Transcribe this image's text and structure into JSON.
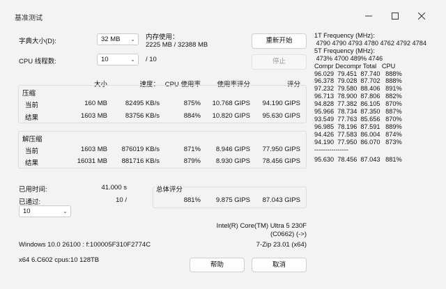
{
  "window": {
    "title": "基准测试"
  },
  "controls": {
    "dict_label": "字典大小(D):",
    "dict_value": "32 MB",
    "threads_label": "CPU 线程数:",
    "threads_value": "10",
    "threads_total": "/ 10",
    "mem_label": "内存使用：",
    "mem_value": "2225 MB / 32388 MB",
    "restart_label": "重新开始",
    "stop_label": "停止"
  },
  "table": {
    "headers": {
      "size": "大小",
      "speed": "速度：",
      "cpu": "CPU 使用率",
      "rating_per_usage": "使用率评分",
      "rating": "评分"
    },
    "compress": {
      "title": "压缩",
      "rows": [
        {
          "label": "当前",
          "size": "160 MB",
          "speed": "82495 KB/s",
          "cpu": "875%",
          "rpu": "10.768 GIPS",
          "rating": "94.190 GIPS"
        },
        {
          "label": "结果",
          "size": "1603 MB",
          "speed": "83756 KB/s",
          "cpu": "884%",
          "rpu": "10.820 GIPS",
          "rating": "95.630 GIPS"
        }
      ]
    },
    "decompress": {
      "title": "解压缩",
      "rows": [
        {
          "label": "当前",
          "size": "1603 MB",
          "speed": "876019 KB/s",
          "cpu": "871%",
          "rpu": "8.946 GIPS",
          "rating": "77.950 GIPS"
        },
        {
          "label": "结果",
          "size": "16031 MB",
          "speed": "881716 KB/s",
          "cpu": "879%",
          "rpu": "8.930 GIPS",
          "rating": "78.456 GIPS"
        }
      ]
    }
  },
  "status": {
    "elapsed_label": "已用时间:",
    "elapsed_value": "41.000 s",
    "passes_label": "已通过:",
    "passes_value": "10 /",
    "passes_combo": "10",
    "total_label": "总体评分",
    "total_cpu": "881%",
    "total_rpu": "9.875 GIPS",
    "total_rating": "87.043 GIPS"
  },
  "sysinfo": {
    "cpu_name": "Intel(R) Core(TM) Ultra 5 230F",
    "cpu_id": "(C0662) (->)",
    "os": "Windows 10.0 26100 : f:100005F310F2774C",
    "zip_version": "7-Zip 23.01 (x64)",
    "arch": "x64 6.C602 cpus:10 128TB"
  },
  "buttons": {
    "help": "帮助",
    "cancel": "取消"
  },
  "right_panel": {
    "lines": [
      "1T Frequency (MHz):",
      " 4790 4790 4793 4780 4762 4792 4784",
      "5T Frequency (MHz):",
      " 473% 4700 489% 4746",
      "Compr Decompr Total   CPU",
      "96.029  79.451  87.740   888%",
      "96.378  79.028  87.702   888%",
      "97.232  79.580  88.406   891%",
      "96.713  78.900  87.806   882%",
      "94.828  77.382  86.105   870%",
      "95.966  78.734  87.350   887%",
      "93.549  77.763  85.656   870%",
      "96.985  78.196  87.591   889%",
      "94.426  77.583  86.004   874%",
      "94.190  77.950  86.070   873%",
      "----------------",
      "95.630  78.456  87.043   881%"
    ]
  }
}
